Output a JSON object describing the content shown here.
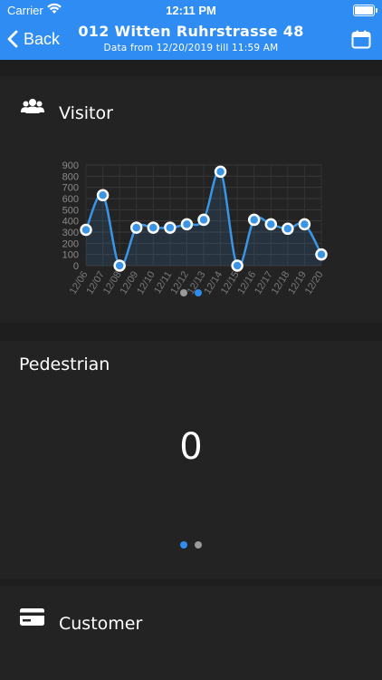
{
  "status_bar": {
    "carrier": "Carrier",
    "time": "12:11 PM"
  },
  "nav": {
    "back_label": "Back",
    "title": "012 Witten Ruhrstrasse 48",
    "subtitle": "Data from 12/20/2019 till 11:59 AM"
  },
  "colors": {
    "accent": "#2f8cf2",
    "background": "#1e1e1e",
    "card": "#232323",
    "page_dot_active": "#2f8cf2",
    "page_dot_inactive": "#9a9a9a"
  },
  "sections": {
    "visitor": {
      "title": "Visitor",
      "icon": "people-icon"
    },
    "pedestrian": {
      "title": "Pedestrian",
      "value": "0"
    },
    "customer": {
      "title": "Customer",
      "icon": "credit-card-icon"
    }
  },
  "pager_visitor": {
    "count": 2,
    "active_index": 1
  },
  "pager_pedestrian": {
    "count": 2,
    "active_index": 0
  },
  "chart_data": {
    "type": "line",
    "categories": [
      "12/06",
      "12/07",
      "12/08",
      "12/09",
      "12/10",
      "12/11",
      "12/12",
      "12/13",
      "12/14",
      "12/15",
      "12/16",
      "12/17",
      "12/18",
      "12/19",
      "12/20"
    ],
    "values": [
      320,
      630,
      0,
      340,
      340,
      340,
      370,
      410,
      840,
      0,
      410,
      370,
      330,
      370,
      100
    ],
    "y_ticks": [
      0,
      100,
      200,
      300,
      400,
      500,
      600,
      700,
      800,
      900
    ],
    "ylim": [
      0,
      900
    ],
    "grid": true,
    "area_fill": true,
    "color": "#3b95e6"
  }
}
